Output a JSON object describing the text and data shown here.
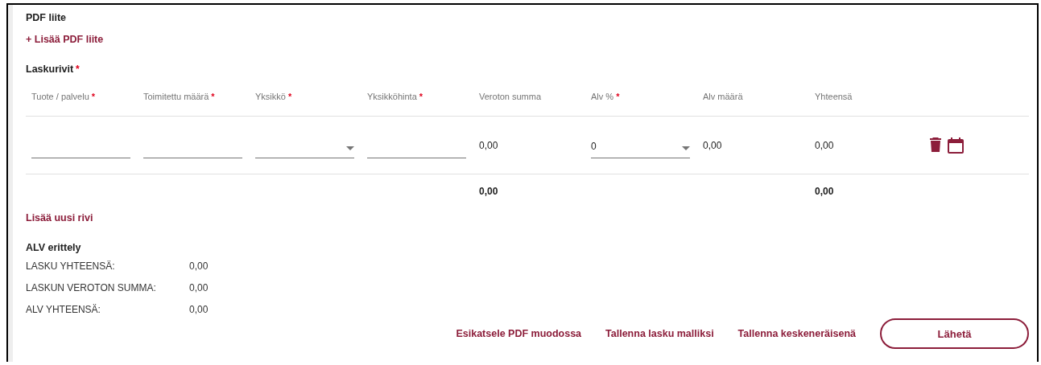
{
  "attachment": {
    "title": "PDF liite",
    "add_link": "+ Lisää PDF liite"
  },
  "invoice_rows": {
    "title": "Laskurivit",
    "mark": "*",
    "columns": [
      {
        "label": "Tuote / palvelu",
        "mark": "*"
      },
      {
        "label": "Toimitettu määrä",
        "mark": "*"
      },
      {
        "label": "Yksikkö",
        "mark": "*"
      },
      {
        "label": "Yksikköhinta",
        "mark": "*"
      },
      {
        "label": "Veroton summa",
        "total": "0,00"
      },
      {
        "label": "Alv %",
        "mark": "*"
      },
      {
        "label": "Alv määrä"
      },
      {
        "label": "Yhteensä",
        "total": "0,00"
      }
    ],
    "rows": [
      {
        "cells": [
          {
            "kind": "input"
          },
          {
            "kind": "input"
          },
          {
            "kind": "select"
          },
          {
            "kind": "input"
          },
          {
            "kind": "value",
            "text": "0,00"
          },
          {
            "kind": "select",
            "value": "0"
          },
          {
            "kind": "value",
            "text": "0,00"
          },
          {
            "kind": "value",
            "text": "0,00"
          },
          {
            "kind": "actions"
          }
        ]
      }
    ],
    "add_row_link": "Lisää uusi rivi"
  },
  "vat_breakdown": {
    "title": "ALV erittely",
    "rows": [
      {
        "label": "LASKU YHTEENSÄ:",
        "value": "0,00"
      },
      {
        "label": "LASKUN VEROTON SUMMA:",
        "value": "0,00"
      },
      {
        "label": "ALV YHTEENSÄ:",
        "value": "0,00"
      }
    ]
  },
  "actions": [
    {
      "kind": "link",
      "label": "Esikatsele PDF muodossa"
    },
    {
      "kind": "link",
      "label": "Tallenna lasku malliksi"
    },
    {
      "kind": "link",
      "label": "Tallenna keskeneräisenä"
    },
    {
      "kind": "button",
      "label": "Lähetä"
    }
  ]
}
